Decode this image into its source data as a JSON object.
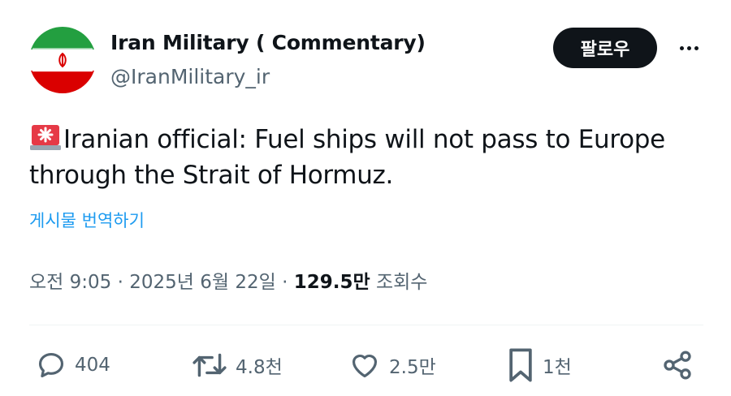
{
  "author": {
    "display_name": "Iran Military ( Commentary)",
    "handle": "@IranMilitary_ir",
    "avatar_icon": "iran-flag-avatar"
  },
  "header": {
    "follow_label": "팔로우",
    "more_icon": "more-dots-icon"
  },
  "tweet": {
    "emoji_icon": "rotating-light-siren-icon",
    "text": "Iranian official: Fuel ships will not pass to Europe through the Strait of Hormuz.",
    "translate_label": "게시물 번역하기"
  },
  "meta": {
    "time": "오전 9:05",
    "separator": " · ",
    "date": "2025년 6월 22일",
    "views_count": "129.5만",
    "views_label": "조회수"
  },
  "actions": {
    "reply_count": "404",
    "retweet_count": "4.8천",
    "like_count": "2.5만",
    "bookmark_count": "1천"
  },
  "colors": {
    "text": "#0f1419",
    "secondary": "#536471",
    "link": "#1d9bf0",
    "button_bg": "#0f1419",
    "flag_green": "#239f40",
    "flag_red": "#da0000"
  }
}
